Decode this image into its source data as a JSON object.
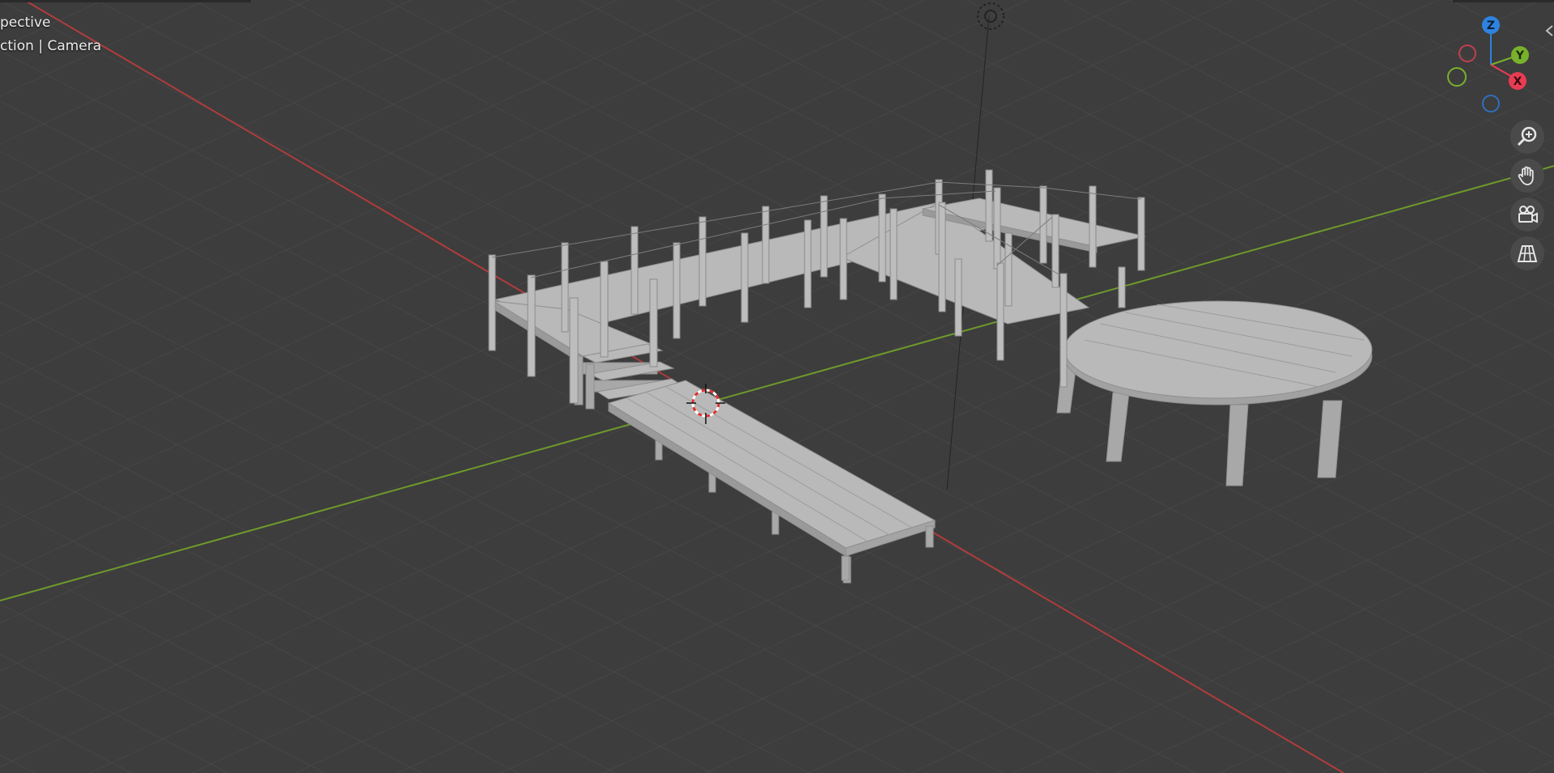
{
  "viewport": {
    "view_mode": "pective",
    "collection_label": "ction | Camera",
    "background": "#3d3d3d"
  },
  "axes": {
    "x_axis_color": "#b03c3c",
    "y_axis_color": "#6e9a2b",
    "z_axis_color": "#2f2f2f"
  },
  "gizmo": {
    "z_label": "Z",
    "y_label": "Y",
    "x_label": "X",
    "z_color": "#2f83e0",
    "y_color": "#78b22c",
    "x_color": "#e83c53"
  },
  "navigation": {
    "buttons": [
      {
        "icon": "zoom-icon",
        "label": "Zoom"
      },
      {
        "icon": "hand-pan-icon",
        "label": "Pan"
      },
      {
        "icon": "camera-view-icon",
        "label": "Camera"
      },
      {
        "icon": "perspective-grid-icon",
        "label": "Projection"
      }
    ]
  },
  "scene": {
    "model_color": "#b9b9b9",
    "objects": [
      "boardwalk-dock",
      "circular-platform",
      "stairs",
      "3d-cursor",
      "camera"
    ]
  }
}
